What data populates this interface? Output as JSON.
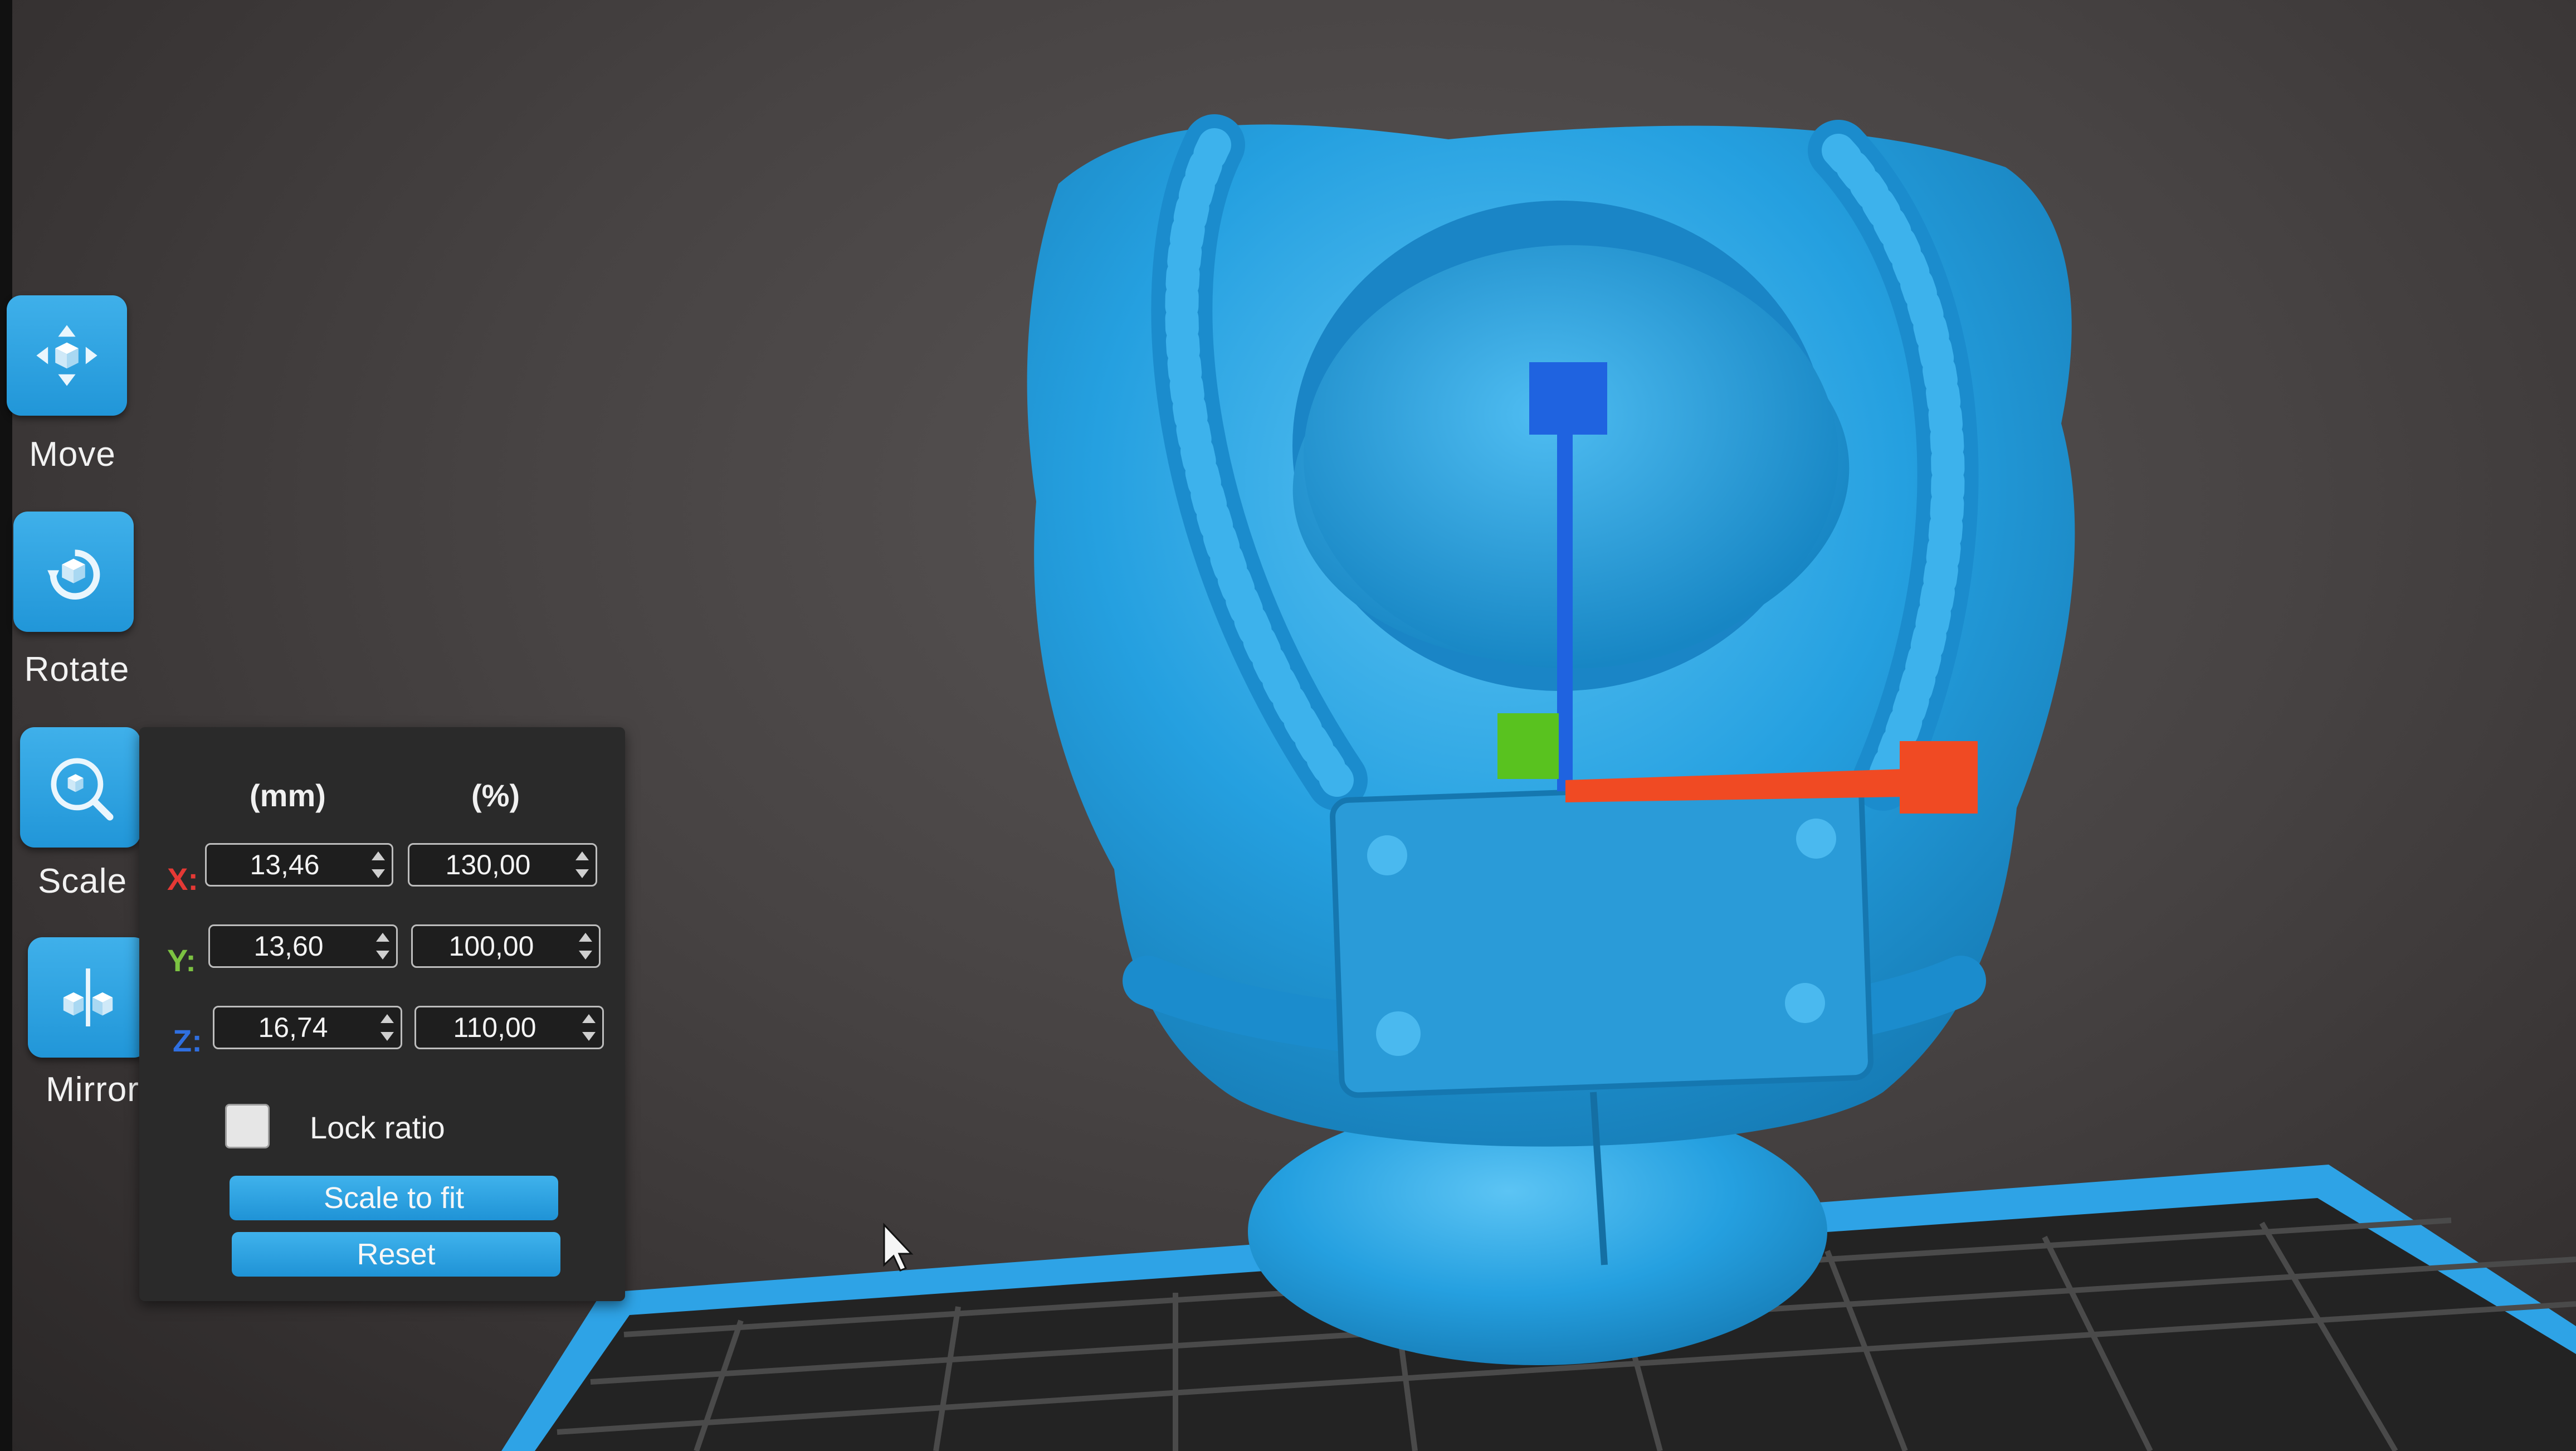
{
  "toolbar": {
    "move": {
      "label": "Move",
      "icon": "move-icon"
    },
    "rotate": {
      "label": "Rotate",
      "icon": "rotate-icon"
    },
    "scale": {
      "label": "Scale",
      "icon": "scale-icon"
    },
    "mirror": {
      "label": "Mirror",
      "icon": "mirror-icon"
    }
  },
  "scale_panel": {
    "col_mm": "(mm)",
    "col_pct": "(%)",
    "rows": [
      {
        "axis": "X:",
        "mm": "13,46",
        "pct": "130,00",
        "color": "#e53935"
      },
      {
        "axis": "Y:",
        "mm": "13,60",
        "pct": "100,00",
        "color": "#7cc242"
      },
      {
        "axis": "Z:",
        "mm": "16,74",
        "pct": "110,00",
        "color": "#2f6fe0"
      }
    ],
    "lock_ratio_label": "Lock ratio",
    "lock_ratio_checked": false,
    "scale_to_fit_label": "Scale to fit",
    "reset_label": "Reset"
  },
  "colors": {
    "accent": "#2aa2e2",
    "model": "#29a3e3",
    "gizmo_x": "#f04a23",
    "gizmo_y": "#59c21f",
    "gizmo_z": "#1f63e0",
    "bed": "#2a2a2a",
    "bed_border": "#2fa4e6"
  }
}
